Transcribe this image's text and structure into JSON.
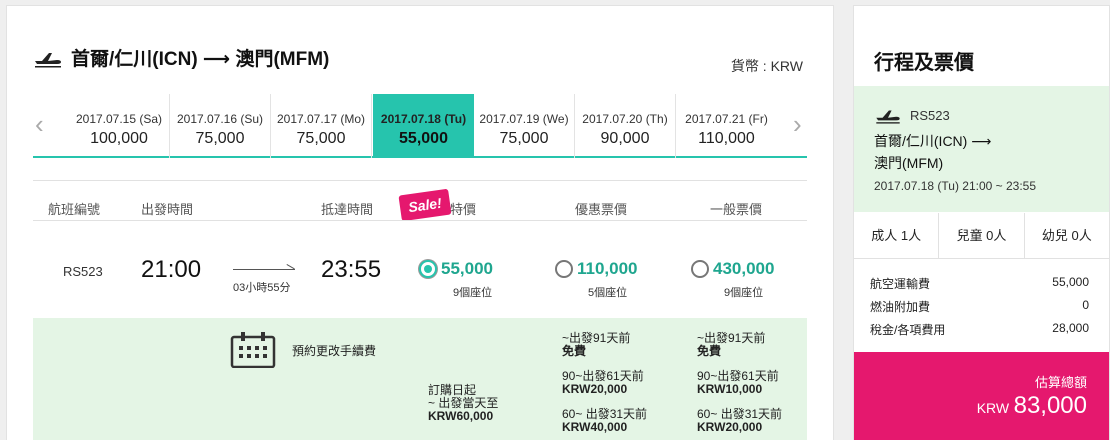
{
  "header": {
    "route": "首爾/仁川(ICN) ⟶ 澳門(MFM)",
    "currency": "貨幣 : KRW"
  },
  "dates": [
    {
      "date": "2017.07.15 (Sa)",
      "price": "100,000"
    },
    {
      "date": "2017.07.16 (Su)",
      "price": "75,000"
    },
    {
      "date": "2017.07.17 (Mo)",
      "price": "75,000"
    },
    {
      "date": "2017.07.18 (Tu)",
      "price": "55,000",
      "selected": true
    },
    {
      "date": "2017.07.19 (We)",
      "price": "75,000"
    },
    {
      "date": "2017.07.20 (Th)",
      "price": "90,000"
    },
    {
      "date": "2017.07.21 (Fr)",
      "price": "110,000"
    }
  ],
  "table": {
    "headers": {
      "flight_no": "航班編號",
      "depart": "出發時間",
      "arrive": "抵達時間",
      "special": "特價",
      "promo": "優惠票價",
      "regular": "一般票價"
    },
    "sale_badge": "Sale!"
  },
  "flight": {
    "number": "RS523",
    "depart": "21:00",
    "arrive": "23:55",
    "duration": "03小時55分",
    "fares": [
      {
        "amount": "55,000",
        "seats": "9個座位",
        "selected": true
      },
      {
        "amount": "110,000",
        "seats": "5個座位",
        "selected": false
      },
      {
        "amount": "430,000",
        "seats": "9個座位",
        "selected": false
      }
    ]
  },
  "change_fee": {
    "label": "預約更改手續費",
    "special": {
      "l1": "訂購日起",
      "l2": "~ 出發當天至",
      "l3": "KRW60,000"
    },
    "promo": {
      "a1": "~出發91天前",
      "a2": "免費",
      "b1": "90~出發61天前",
      "b2": "KRW20,000",
      "c1": "60~ 出發31天前",
      "c2": "KRW40,000"
    },
    "regular": {
      "a1": "~出發91天前",
      "a2": "免費",
      "b1": "90~出發61天前",
      "b2": "KRW10,000",
      "c1": "60~ 出發31天前",
      "c2": "KRW20,000"
    }
  },
  "sidebar": {
    "title": "行程及票價",
    "flight_code": "RS523",
    "route_line1": "首爾/仁川(ICN) ⟶",
    "route_line2": "澳門(MFM)",
    "when": "2017.07.18 (Tu) 21:00 ~ 23:55",
    "pax": [
      "成人 1人",
      "兒童 0人",
      "幼兒 0人"
    ],
    "fees": [
      {
        "label": "航空運輸費",
        "value": "55,000"
      },
      {
        "label": "燃油附加費",
        "value": "0"
      },
      {
        "label": "稅金/各項費用",
        "value": "28,000"
      }
    ],
    "total_label": "估算總額",
    "total_currency": "KRW",
    "total_value": "83,000"
  },
  "colors": {
    "accent": "#26c4ad",
    "fare_green": "#1fa68f",
    "brand_pink": "#e5186e",
    "info_bg": "#e4f5e5"
  },
  "icons": {
    "plane": "airplane-takeoff-icon",
    "calendar": "calendar-icon",
    "prev": "chevron-left-icon",
    "next": "chevron-right-icon"
  }
}
